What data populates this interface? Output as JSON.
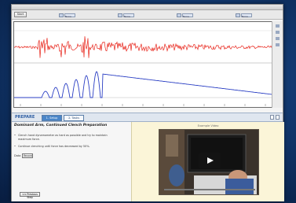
{
  "toolbar": {
    "start_label": "Start"
  },
  "channels": [
    {
      "label": "None"
    },
    {
      "label": "None"
    },
    {
      "label": "None"
    },
    {
      "label": "None"
    }
  ],
  "lesson": {
    "section": "PREPARE",
    "tabs": [
      {
        "label": "1. Setup"
      },
      {
        "label": "2. Tasks"
      }
    ],
    "title": "Dominant Arm, Continued Clench Preparation",
    "steps": [
      "Clench hand dynamometer as hard as possible and try to maintain maximum force.",
      "Continue clenching until force has decreased by 50%."
    ],
    "data_label": "Data",
    "record_label": "Record",
    "prev_label": "<< Previous Step",
    "video_label": "Example Video"
  },
  "colors": {
    "emg": "#e8251b",
    "force": "#2b3fc4",
    "accent": "#4a86c8"
  }
}
